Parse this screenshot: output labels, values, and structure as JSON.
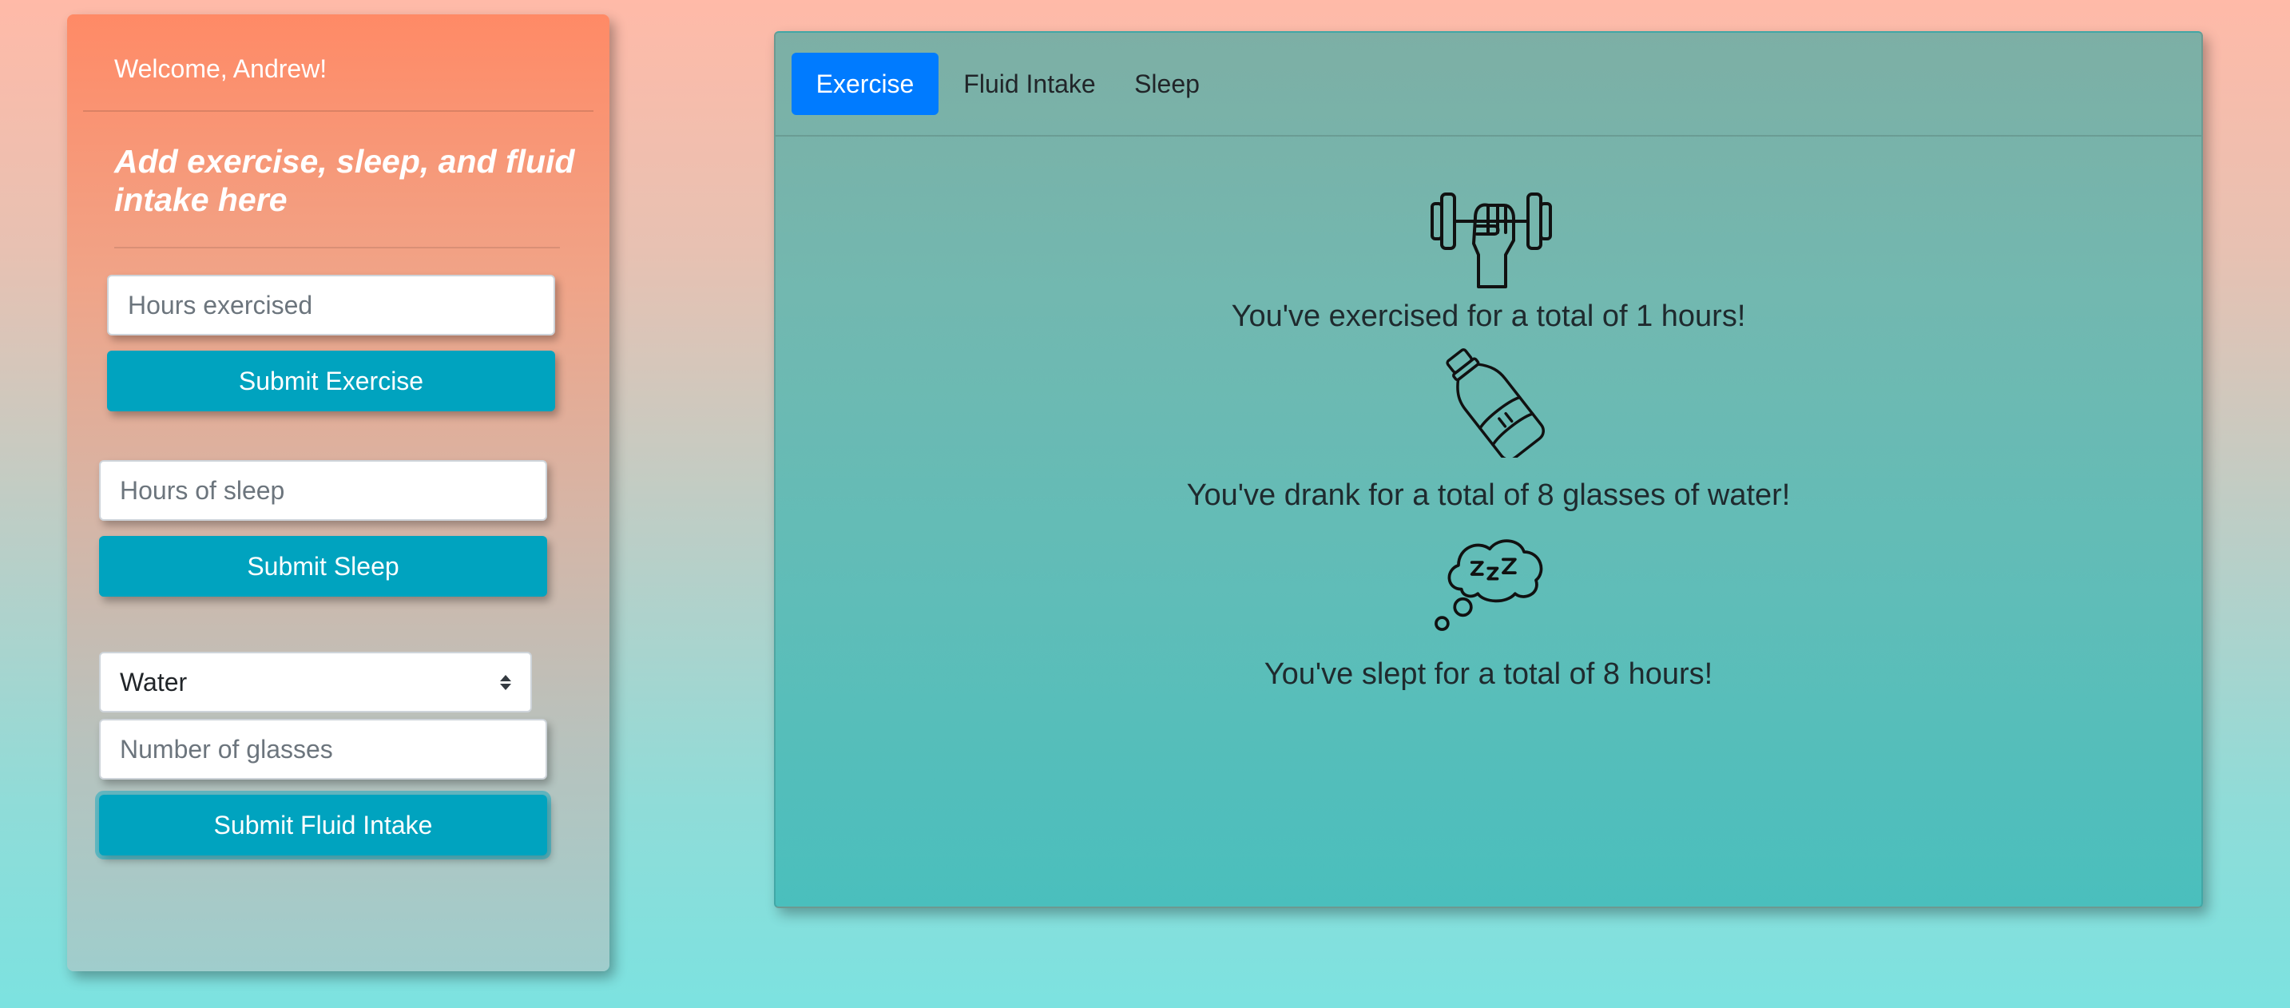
{
  "sidebar": {
    "welcome": "Welcome, Andrew!",
    "subtitle": "Add exercise, sleep, and fluid intake here",
    "exercise_input_placeholder": "Hours exercised",
    "exercise_button": "Submit Exercise",
    "sleep_input_placeholder": "Hours of sleep",
    "sleep_button": "Submit Sleep",
    "fluid_select_value": "Water",
    "fluid_input_placeholder": "Number of glasses",
    "fluid_button": "Submit Fluid Intake"
  },
  "main": {
    "tabs": [
      {
        "label": "Exercise",
        "active": true
      },
      {
        "label": "Fluid Intake",
        "active": false
      },
      {
        "label": "Sleep",
        "active": false
      }
    ],
    "stats": {
      "exercise": {
        "icon": "dumbbell-icon",
        "text": "You've exercised for a total of 1 hours!"
      },
      "fluid": {
        "icon": "water-bottle-icon",
        "text": "You've drank for a total of 8 glasses of water!"
      },
      "sleep": {
        "icon": "sleep-cloud-icon",
        "text": "You've slept for a total of 8 hours!"
      }
    }
  },
  "colors": {
    "button_teal": "#00a3bf",
    "tab_active": "#007bff"
  }
}
